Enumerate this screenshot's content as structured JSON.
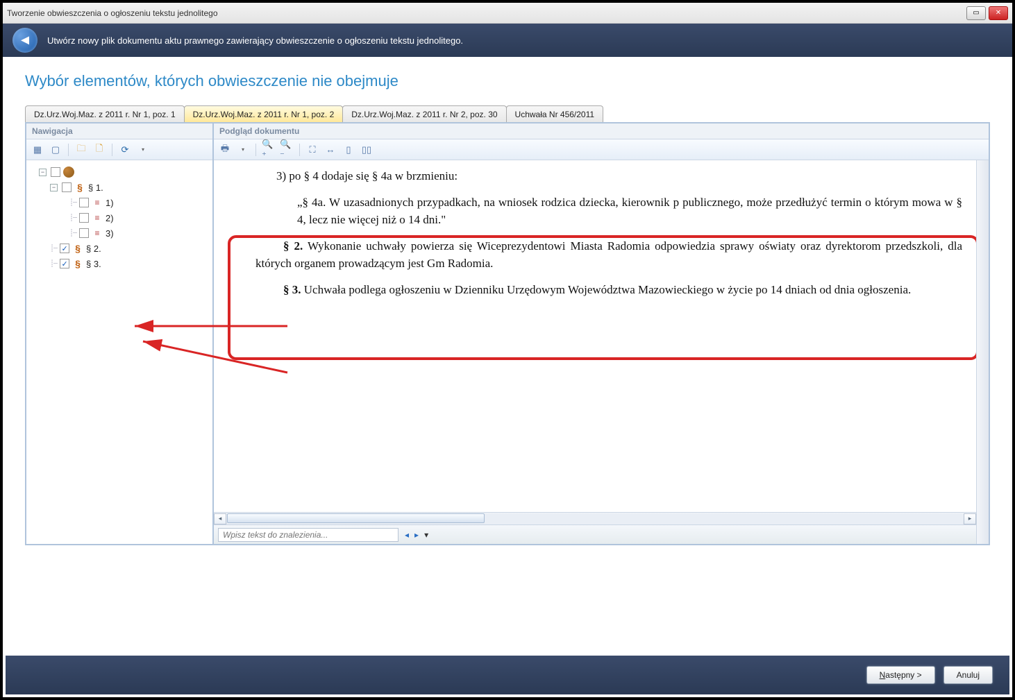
{
  "window": {
    "title": "Tworzenie obwieszczenia o ogłoszeniu tekstu jednolitego"
  },
  "banner": {
    "text": "Utwórz nowy plik dokumentu aktu prawnego zawierający obwieszczenie o ogłoszeniu tekstu jednolitego."
  },
  "section_title": "Wybór elementów, których obwieszczenie nie obejmuje",
  "tabs": [
    {
      "label": "Dz.Urz.Woj.Maz. z 2011 r. Nr 1, poz. 1",
      "active": false
    },
    {
      "label": "Dz.Urz.Woj.Maz. z 2011 r. Nr 1, poz. 2",
      "active": true
    },
    {
      "label": "Dz.Urz.Woj.Maz. z 2011 r. Nr 2, poz. 30",
      "active": false
    },
    {
      "label": "Uchwała Nr 456/2011",
      "active": false
    }
  ],
  "nav": {
    "title": "Nawigacja",
    "items": [
      {
        "level": 0,
        "checked": false,
        "icon": "globe",
        "label": ""
      },
      {
        "level": 1,
        "checked": false,
        "icon": "sect",
        "label": "§ 1.",
        "expandable": true,
        "expanded": true
      },
      {
        "level": 2,
        "checked": false,
        "icon": "list",
        "label": "1)"
      },
      {
        "level": 2,
        "checked": false,
        "icon": "list",
        "label": "2)"
      },
      {
        "level": 2,
        "checked": false,
        "icon": "list",
        "label": "3)"
      },
      {
        "level": 1,
        "checked": true,
        "icon": "sect",
        "label": "§ 2."
      },
      {
        "level": 1,
        "checked": true,
        "icon": "sect",
        "label": "§ 3."
      }
    ]
  },
  "doc": {
    "title": "Podgląd dokumentu",
    "p1": "3) po § 4 dodaje się § 4a w brzmieniu:",
    "p2": "„§ 4a. W uzasadnionych przypadkach, na wniosek rodzica dziecka, kierownik p publicznego, może przedłużyć termin o którym mowa w § 4, lecz nie więcej niż o 14 dni.\"",
    "p3_b": "§ 2.",
    "p3": " Wykonanie uchwały powierza się Wiceprezydentowi Miasta Radomia odpowiedzia sprawy oświaty oraz dyrektorom przedszkoli, dla których organem prowadzącym jest Gm Radomia.",
    "p4_b": "§ 3.",
    "p4": " Uchwała podlega ogłoszeniu w Dzienniku Urzędowym Województwa Mazowieckiego w życie po 14 dniach od dnia ogłoszenia.",
    "search_placeholder": "Wpisz tekst do znalezienia..."
  },
  "footer": {
    "next": "Następny >",
    "next_u": "N",
    "next_rest": "astępny >",
    "cancel": "Anuluj"
  }
}
